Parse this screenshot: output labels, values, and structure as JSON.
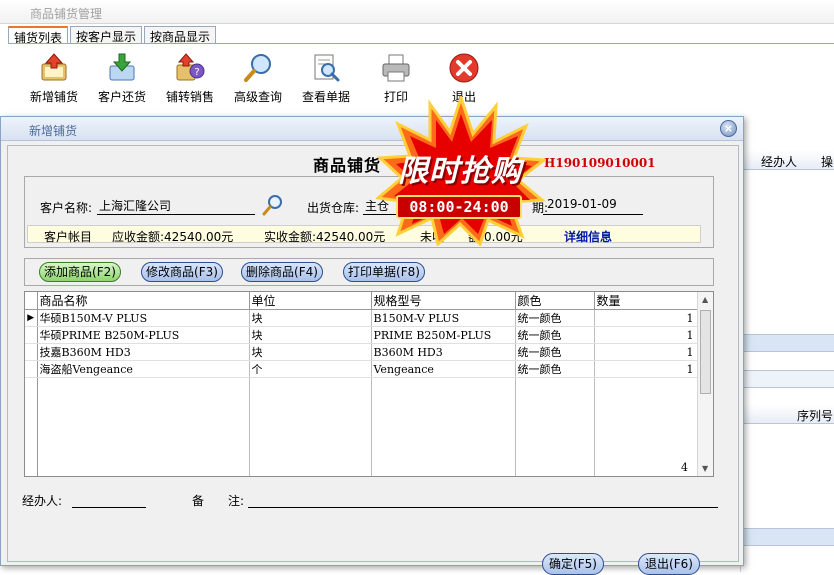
{
  "app": {
    "title": "商品铺货管理"
  },
  "tabs": [
    {
      "label": "铺货列表"
    },
    {
      "label": "按客户显示"
    },
    {
      "label": "按商品显示"
    }
  ],
  "toolbar": {
    "items": [
      {
        "label": "新增铺货",
        "icon": "add-document-icon"
      },
      {
        "label": "客户还货",
        "icon": "return-download-icon"
      },
      {
        "label": "铺转销售",
        "icon": "convert-sales-icon"
      },
      {
        "label": "高级查询",
        "icon": "magnifier-icon"
      },
      {
        "label": "查看单据",
        "icon": "view-document-icon"
      },
      {
        "label": "打印",
        "icon": "printer-icon"
      },
      {
        "label": "退出",
        "icon": "exit-x-icon"
      }
    ]
  },
  "right_pane": {
    "col1": "经办人",
    "col2": "操",
    "col3": "序列号"
  },
  "dialog": {
    "title": "新增铺货",
    "heading": "商品铺货",
    "order_no": "H190109010001",
    "customer_label": "客户名称:",
    "customer_value": "上海汇隆公司",
    "warehouse_label": "出货仓库:",
    "warehouse_value": "主仓",
    "date_label_tail": "期:",
    "date_value": "2019-01-09",
    "account_label": "客户帐目",
    "receivable": "应收金额:42540.00元",
    "received": "实收金额:42540.00元",
    "unreceived": "未收",
    "unreceived_tail": "额:0.00元",
    "detail_link": "详细信息",
    "buttons": {
      "add": "添加商品(F2)",
      "edit": "修改商品(F3)",
      "delete": "删除商品(F4)",
      "print": "打印单据(F8)"
    },
    "grid": {
      "columns": [
        "商品名称",
        "单位",
        "规格型号",
        "颜色",
        "数量"
      ],
      "rows": [
        {
          "name": "华硕B150M-V PLUS",
          "unit": "块",
          "spec": "B150M-V PLUS",
          "color": "统一颜色",
          "qty": "1"
        },
        {
          "name": "华硕PRIME B250M-PLUS",
          "unit": "块",
          "spec": "PRIME B250M-PLUS",
          "color": "统一颜色",
          "qty": "1"
        },
        {
          "name": "技嘉B360M HD3",
          "unit": "块",
          "spec": "B360M HD3",
          "color": "统一颜色",
          "qty": "1"
        },
        {
          "name": "海盗船Vengeance",
          "unit": "个",
          "spec": "Vengeance",
          "color": "统一颜色",
          "qty": "1"
        }
      ],
      "row_count": "4"
    },
    "handler_label": "经办人:",
    "remark_label_1": "备",
    "remark_label_2": "注:",
    "ok_button": "确定(F5)",
    "exit_button": "退出(F6)"
  },
  "promo": {
    "headline": "限时抢购",
    "hours": "08:00-24:00"
  },
  "colors": {
    "order_no": "#d10000",
    "link": "#0019a6",
    "promo_red": "#e60000"
  }
}
